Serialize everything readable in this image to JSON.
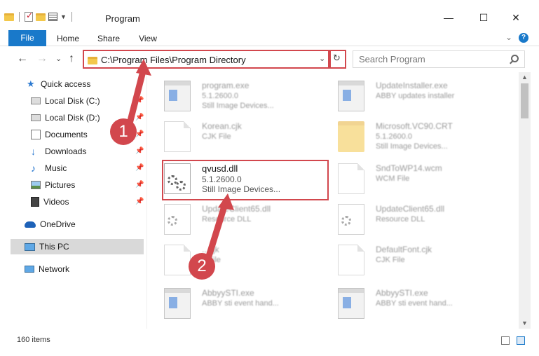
{
  "window": {
    "title": "Program",
    "minimize": "—",
    "maximize": "☐",
    "close": "✕"
  },
  "ribbon": {
    "tabs": [
      "File",
      "Home",
      "Share",
      "View"
    ],
    "expand": "⌄",
    "help": "?"
  },
  "nav": {
    "back": "←",
    "forward": "→",
    "recent": "⌄",
    "up": "↑",
    "address": "C:\\Program Files\\Program Directory",
    "address_dropdown": "⌄",
    "refresh": "↻",
    "search_placeholder": "Search Program"
  },
  "sidebar": {
    "items": [
      {
        "label": "Quick access",
        "icon": "star-icon"
      },
      {
        "label": "Local Disk (C:)",
        "icon": "drive-icon"
      },
      {
        "label": "Local Disk (D:)",
        "icon": "drive-icon"
      },
      {
        "label": "Documents",
        "icon": "documents-icon"
      },
      {
        "label": "Downloads",
        "icon": "download-icon"
      },
      {
        "label": "Music",
        "icon": "music-icon"
      },
      {
        "label": "Pictures",
        "icon": "pictures-icon"
      },
      {
        "label": "Videos",
        "icon": "videos-icon"
      },
      {
        "label": "OneDrive",
        "icon": "cloud-icon"
      },
      {
        "label": "This PC",
        "icon": "computer-icon"
      },
      {
        "label": "Network",
        "icon": "network-icon"
      }
    ]
  },
  "files": [
    {
      "name": "program.exe",
      "line2": "5.1.2600.0",
      "line3": "Still Image Devices...",
      "icon": "exe-icon"
    },
    {
      "name": "UpdateInstaller.exe",
      "line2": "ABBY updates installer",
      "line3": "",
      "icon": "exe-icon"
    },
    {
      "name": "Korean.cjk",
      "line2": "CJK File",
      "line3": "",
      "icon": "document-icon"
    },
    {
      "name": "Microsoft.VC90.CRT",
      "line2": "5.1.2600.0",
      "line3": "Still Image Devices...",
      "icon": "folder-icon"
    },
    {
      "name": "qvusd.dll",
      "line2": "5.1.2600.0",
      "line3": "Still Image Devices...",
      "icon": "dll-gear-icon"
    },
    {
      "name": "SndToWP14.wcm",
      "line2": "WCM File",
      "line3": "",
      "icon": "document-icon"
    },
    {
      "name": "UpdateClient65.dll",
      "line2": "Resource DLL",
      "line3": "",
      "icon": "dll-gear-icon"
    },
    {
      "name": "UpdateClient65.dll",
      "line2": "Resource DLL",
      "line3": "",
      "icon": "dll-gear-icon"
    },
    {
      "name": "...cjk",
      "line2": "...File",
      "line3": "",
      "icon": "document-icon"
    },
    {
      "name": "DefaultFont.cjk",
      "line2": "CJK File",
      "line3": "",
      "icon": "document-icon"
    },
    {
      "name": "AbbyySTI.exe",
      "line2": "ABBY sti event hand...",
      "line3": "",
      "icon": "exe-icon"
    },
    {
      "name": "AbbyySTI.exe",
      "line2": "ABBY sti event hand...",
      "line3": "",
      "icon": "exe-icon"
    }
  ],
  "status": {
    "count": "160 items"
  },
  "callouts": [
    "1",
    "2"
  ],
  "colors": {
    "accent": "#1979ca",
    "highlight": "#d2474d"
  }
}
